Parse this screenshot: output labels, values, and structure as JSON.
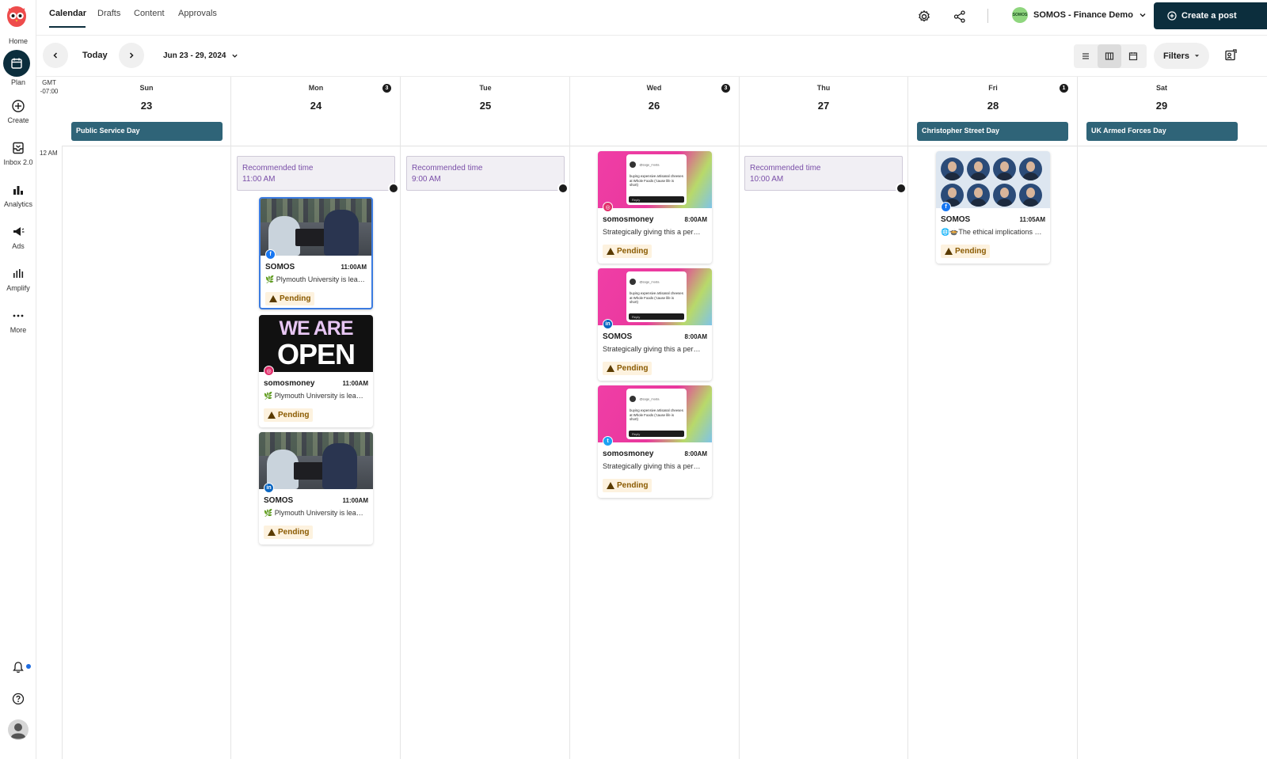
{
  "rail": {
    "items": [
      {
        "label": "Home"
      },
      {
        "label": "Plan"
      },
      {
        "label": "Create"
      },
      {
        "label": "Inbox 2.0"
      },
      {
        "label": "Analytics"
      },
      {
        "label": "Ads"
      },
      {
        "label": "Amplify"
      },
      {
        "label": "More"
      }
    ]
  },
  "topbar": {
    "tabs": [
      {
        "label": "Calendar",
        "active": true
      },
      {
        "label": "Drafts"
      },
      {
        "label": "Content"
      },
      {
        "label": "Approvals"
      }
    ],
    "org_avatar_text": "SOMOS",
    "org_name": "SOMOS - Finance Demo",
    "create_label": "Create a post"
  },
  "toolbar": {
    "today_label": "Today",
    "date_range": "Jun 23 - 29, 2024",
    "filters_label": "Filters"
  },
  "calendar": {
    "timezone_line1": "GMT",
    "timezone_line2": "-07:00",
    "hour_label": "12 AM",
    "days": [
      {
        "name": "Sun",
        "num": "23",
        "holiday": "Public Service Day"
      },
      {
        "name": "Mon",
        "num": "24",
        "count": "3",
        "recommended_title": "Recommended time",
        "recommended_time": "11:00 AM"
      },
      {
        "name": "Tue",
        "num": "25",
        "recommended_title": "Recommended time",
        "recommended_time": "9:00 AM"
      },
      {
        "name": "Wed",
        "num": "26",
        "count": "3"
      },
      {
        "name": "Thu",
        "num": "27",
        "recommended_title": "Recommended time",
        "recommended_time": "10:00 AM"
      },
      {
        "name": "Fri",
        "num": "28",
        "count": "1",
        "holiday": "Christopher Street Day"
      },
      {
        "name": "Sat",
        "num": "29",
        "holiday": "UK Armed Forces Day"
      }
    ],
    "posts": [
      {
        "account": "SOMOS",
        "time": "11:00AM",
        "text": "🌿 Plymouth University is lea…",
        "status": "Pending",
        "network": "facebook",
        "thumb": "meeting"
      },
      {
        "account": "somosmoney",
        "time": "11:00AM",
        "text": "🌿 Plymouth University is lea…",
        "status": "Pending",
        "network": "instagram",
        "thumb": "open",
        "thumb_line1": "WE ARE",
        "thumb_line2": "OPEN"
      },
      {
        "account": "SOMOS",
        "time": "11:00AM",
        "text": "🌿 Plymouth University is lea…",
        "status": "Pending",
        "network": "linkedin",
        "thumb": "meeting"
      },
      {
        "account": "somosmoney",
        "time": "8:00AM",
        "text": "Strategically giving this a per…",
        "status": "Pending",
        "network": "instagram",
        "thumb": "pink",
        "tweet_user": "@sage_moda",
        "tweet_text": "buying expensive artisanal cheeses at Whole Foods ('cause life is short)",
        "tweet_reply": "Reply"
      },
      {
        "account": "SOMOS",
        "time": "8:00AM",
        "text": "Strategically giving this a per…",
        "status": "Pending",
        "network": "linkedin",
        "thumb": "pink",
        "tweet_user": "@sage_moda",
        "tweet_text": "buying expensive artisanal cheeses at Whole Foods ('cause life is short)",
        "tweet_reply": "Reply"
      },
      {
        "account": "somosmoney",
        "time": "8:00AM",
        "text": "Strategically giving this a per…",
        "status": "Pending",
        "network": "twitter",
        "thumb": "pink",
        "tweet_user": "@sage_moda",
        "tweet_text": "buying expensive artisanal cheeses at Whole Foods ('cause life is short)",
        "tweet_reply": "Reply"
      },
      {
        "account": "SOMOS",
        "time": "11:05AM",
        "text": "🌐🍲The ethical implications …",
        "status": "Pending",
        "network": "facebook",
        "thumb": "faces"
      }
    ]
  },
  "colors": {
    "brand_dark": "#0c2e3d",
    "holiday": "#2f6478",
    "recommended_text": "#7a4fa8",
    "pending_bg": "#fdf2df",
    "selected_border": "#3b7be0"
  }
}
